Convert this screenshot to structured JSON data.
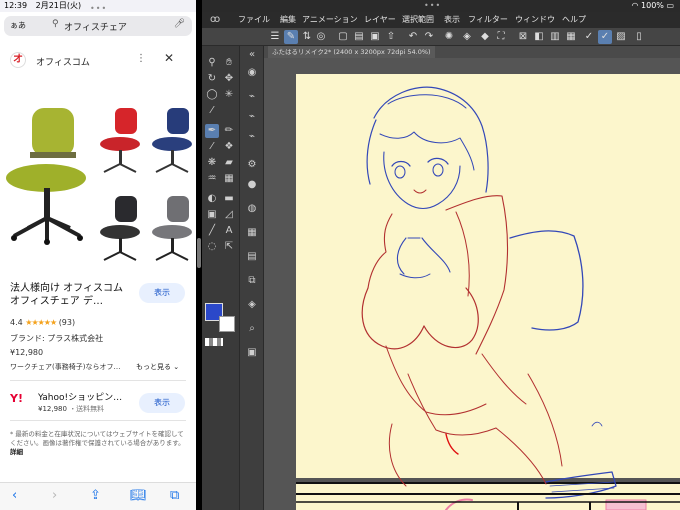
{
  "status": {
    "time": "12:39",
    "date": "2月21日(火)",
    "battery": "100%"
  },
  "safari": {
    "aa_label": "ぁあ",
    "url": "オフィスチェア",
    "site_name": "オフィスコム",
    "product_title": "法人様向け オフィスコム オフィスチェア デ…",
    "show_label": "表示",
    "rating_value": "4.4",
    "rating_stars": "★★★★★",
    "rating_count": "(93)",
    "brand": "ブランド: プラス株式会社",
    "price": "¥12,980",
    "more_text": "ワークチェア(事務椅子)ならオフ…",
    "see_more": "もっと見る ⌄",
    "shop_name": "Yahoo!ショッピン…",
    "shop_price": "¥12,980",
    "shop_shipping": "・送料無料",
    "shop_show_label": "表示",
    "disclaimer": "* 最新の料金と在庫状況についてはウェブサイトを確認してください。画像は著作権で保護されている場合があります。",
    "disclaimer_link": "詳細"
  },
  "csp": {
    "menu": [
      "ファイル",
      "編集",
      "アニメーション",
      "レイヤー",
      "選択範囲",
      "表示",
      "フィルター",
      "ウィンドウ",
      "ヘルプ"
    ],
    "tab_title": "ふたはるリメイク2* (2400 x 3200px 72dpi 54.0%)"
  },
  "colors": {
    "main_color": "#2b48c9",
    "sub_color": "#ffffff",
    "paper": "#fcf6cc",
    "accent": "#5a7fb0"
  }
}
